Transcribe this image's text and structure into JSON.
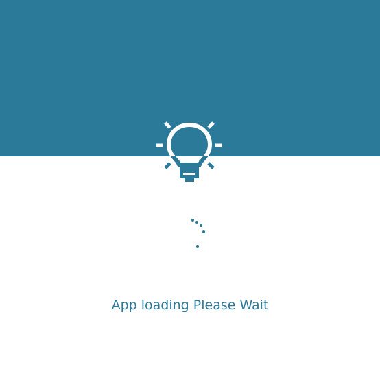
{
  "app": {
    "status_message": "App loading Please Wait",
    "icon": "lightbulb-icon",
    "spinner_icon": "loading-spinner-icon"
  },
  "colors": {
    "brand": "#2c7a9a",
    "background": "#ffffff"
  }
}
